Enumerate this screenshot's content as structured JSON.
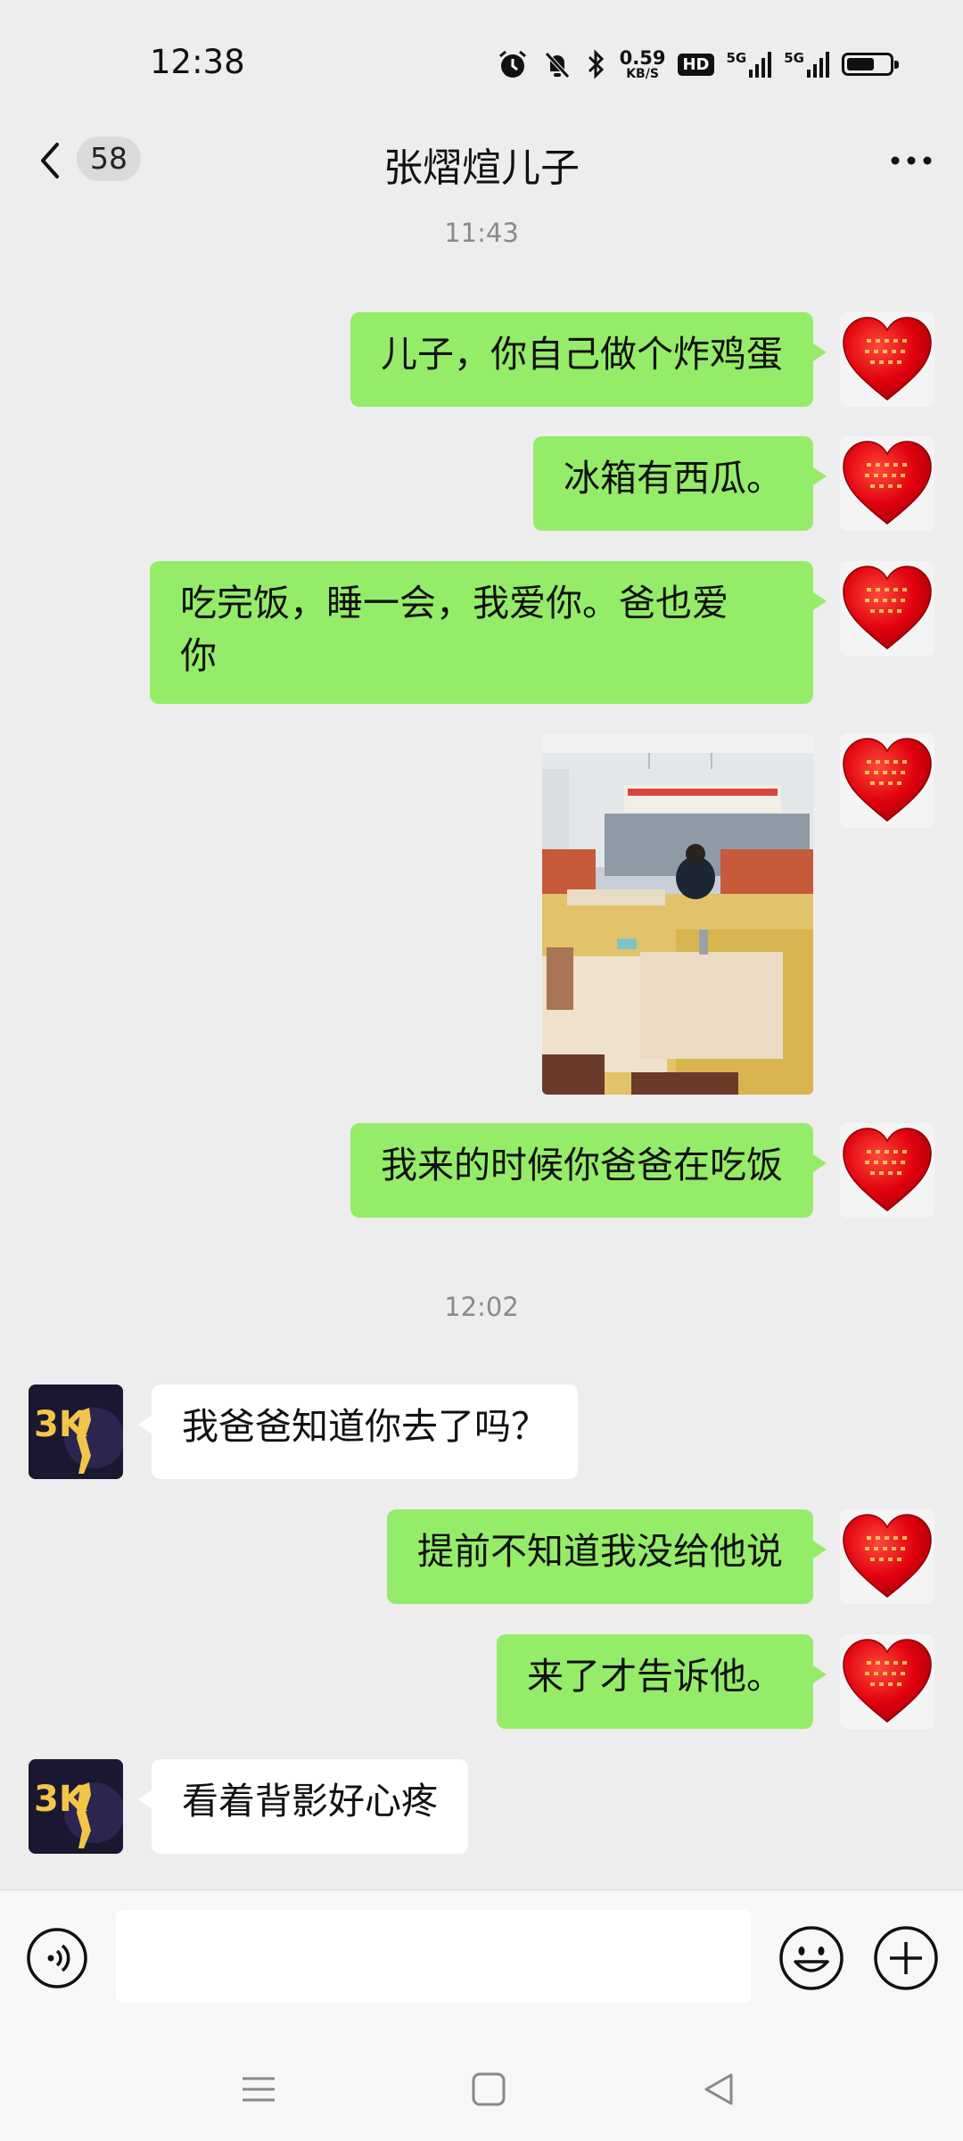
{
  "status_bar": {
    "time": "12:38",
    "speed_value": "0.59",
    "speed_unit": "KB/S",
    "hd_label": "HD",
    "network_1": "5G",
    "network_2": "5G",
    "battery_level": 0.7
  },
  "header": {
    "unread_count": "58",
    "title": "张熠煊儿子"
  },
  "messages": {
    "ts1": "11:43",
    "m1": "儿子，你自己做个炸鸡蛋",
    "m2": "冰箱有西瓜。",
    "m3_line1": "吃完饭，睡一会，我爱你。爸也爱",
    "m3_line2": "你",
    "m5": "我来的时候你爸爸在吃饭",
    "ts2": "12:02",
    "m6": "我爸爸知道你去了吗？",
    "m7": "提前不知道我没给他说",
    "m8": "来了才告诉他。",
    "m9": "看着背影好心疼"
  },
  "avatar_other_text": "3K",
  "colors": {
    "sent_bubble": "#95ec69",
    "received_bubble": "#ffffff",
    "background": "#ededed"
  },
  "icons": {
    "back": "chevron-left-icon",
    "more": "more-dots-icon",
    "voice": "voice-icon",
    "emoji": "emoji-icon",
    "plus": "plus-icon"
  }
}
